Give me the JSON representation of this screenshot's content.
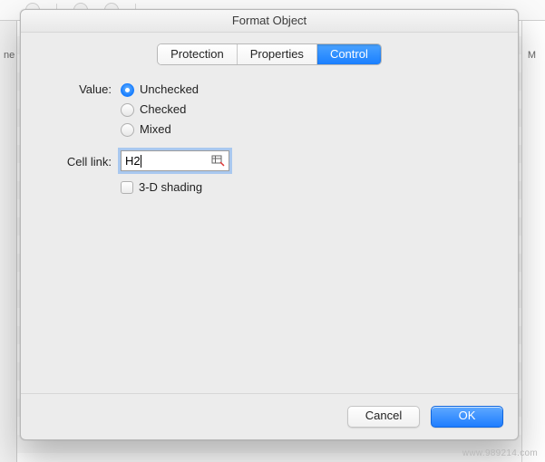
{
  "background": {
    "col_left_hint": "ne",
    "col_right_hint": "M"
  },
  "dialog": {
    "title": "Format Object",
    "tabs": {
      "protection": "Protection",
      "properties": "Properties",
      "control": "Control",
      "active": "control"
    },
    "form": {
      "value_label": "Value:",
      "radio_unchecked": "Unchecked",
      "radio_checked": "Checked",
      "radio_mixed": "Mixed",
      "selected_radio": "unchecked",
      "cell_link_label": "Cell link:",
      "cell_link_value": "H2",
      "shading_label": "3-D shading",
      "shading_checked": false
    },
    "buttons": {
      "cancel": "Cancel",
      "ok": "OK"
    }
  },
  "watermark": "www.989214.com"
}
